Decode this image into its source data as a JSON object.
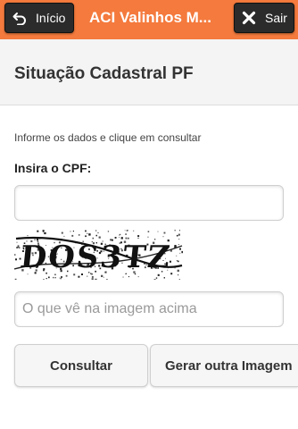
{
  "topbar": {
    "back_label": "Início",
    "title": "ACI Valinhos M...",
    "exit_label": "Sair",
    "background": "#f47a3d",
    "back_icon": "undo-arrow-icon",
    "exit_icon": "close-icon"
  },
  "page": {
    "title": "Situação Cadastral PF"
  },
  "form": {
    "instructions": "Informe os dados e clique em consultar",
    "cpf_label": "Insira o CPF:",
    "cpf_value": "",
    "captcha_text": "DOS3TZ",
    "captcha_placeholder": "O que vê na imagem acima",
    "captcha_value": ""
  },
  "buttons": {
    "consultar": "Consultar",
    "gerar": "Gerar outra Imagem"
  }
}
